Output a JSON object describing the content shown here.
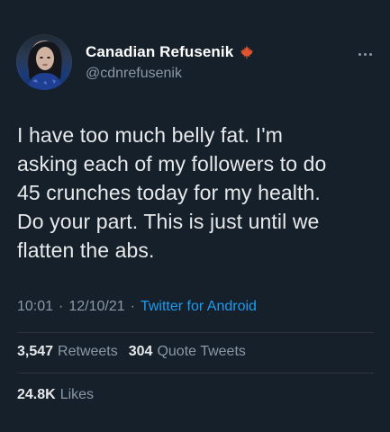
{
  "user": {
    "display_name": "Canadian Refusenik",
    "handle": "@cdnrefusenik",
    "badge_icon": "maple-leaf-icon",
    "avatar": "profile-photo"
  },
  "tweet": {
    "lines": [
      "I have too much belly fat. I'm",
      "asking each of my followers to do",
      "45 crunches today for my health.",
      "Do your part. This is just until we",
      "flatten the abs."
    ],
    "time": "10:01",
    "separator": "·",
    "date": "12/10/21",
    "source": "Twitter for Android"
  },
  "stats": {
    "retweets_count": "3,547",
    "retweets_label": "Retweets",
    "quotes_count": "304",
    "quotes_label": "Quote Tweets",
    "likes_count": "24.8K",
    "likes_label": "Likes"
  },
  "menu": {
    "icon": "more-horizontal-icon"
  },
  "colors": {
    "background": "#15202b",
    "text": "#e7e9ea",
    "secondary": "#8b98a5",
    "link": "#1d9bf0",
    "divider": "#2f3336",
    "maple_leaf": "#e0542f"
  }
}
